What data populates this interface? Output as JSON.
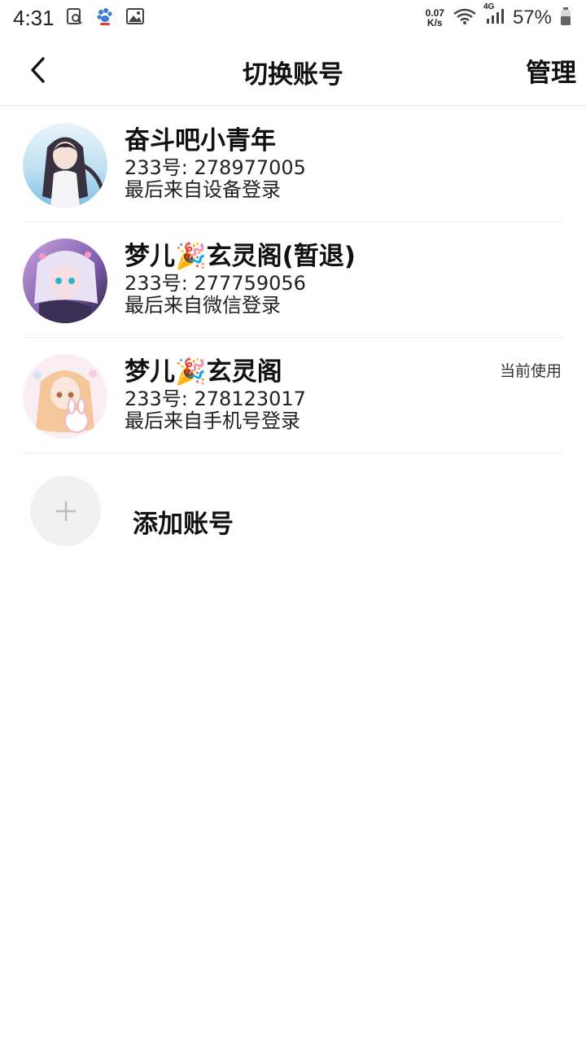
{
  "status_bar": {
    "time": "4:31",
    "net_speed_value": "0.07",
    "net_speed_unit": "K/s",
    "network_type": "4G",
    "battery": "57%"
  },
  "header": {
    "title": "切换账号",
    "manage_label": "管理"
  },
  "accounts": [
    {
      "name": "奋斗吧小青年",
      "id_line": "233号: 278977005",
      "source": "最后来自设备登录",
      "current": false,
      "current_label": ""
    },
    {
      "name": "梦儿🎉玄灵阁(暂退)",
      "id_line": "233号: 277759056",
      "source": "最后来自微信登录",
      "current": false,
      "current_label": ""
    },
    {
      "name": "梦儿🎉玄灵阁",
      "id_line": "233号: 278123017",
      "source": "最后来自手机号登录",
      "current": true,
      "current_label": "当前使用"
    }
  ],
  "add_account": {
    "label": "添加账号"
  },
  "colors": {
    "divider": "#ececec",
    "add_circle_bg": "#f1f1f1",
    "plus_icon": "#bdbdbd"
  }
}
